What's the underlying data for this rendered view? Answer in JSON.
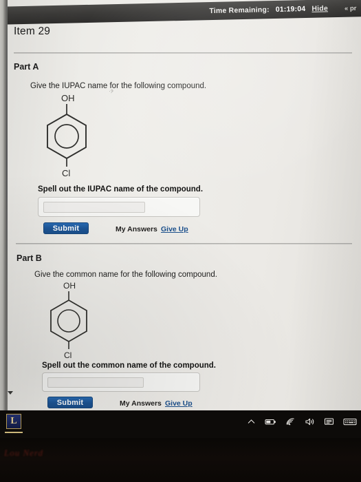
{
  "timer_bar": {
    "label": "Time Remaining:",
    "value": "01:19:04",
    "hide_label": "Hide",
    "prev_label": "« pr"
  },
  "item": {
    "title": "Item 29"
  },
  "part_a": {
    "label": "Part A",
    "prompt": "Give the IUPAC name for the following compound.",
    "speck": "·?",
    "structure": {
      "top_label": "OH",
      "bottom_label": "Cl"
    },
    "spell_label": "Spell out the IUPAC name of the compound.",
    "answer_value": "",
    "submit_label": "Submit",
    "my_answers_label": "My Answers",
    "give_up_label": "Give Up"
  },
  "part_b": {
    "label": "Part B",
    "prompt": "Give the common name for the following compound.",
    "structure": {
      "top_label": "OH",
      "bottom_label": "Cl"
    },
    "spell_label": "Spell out the common name of the compound.",
    "answer_value": "",
    "submit_label": "Submit",
    "my_answers_label": "My Answers",
    "give_up_label": "Give Up"
  },
  "taskbar": {
    "app_glyph": "L",
    "tray": [
      "chevron-up-icon",
      "battery-icon",
      "wifi-icon",
      "volume-icon",
      "notification-icon",
      "keyboard-icon"
    ]
  },
  "desk": {
    "reflection_text": "Lou Nerd"
  },
  "colors": {
    "accent_blue": "#1a4f8c",
    "link_blue": "#1a4f8c",
    "page_background": "#eceae6",
    "timer_bar": "#3c3b39",
    "taskbar": "#0d0b09"
  }
}
